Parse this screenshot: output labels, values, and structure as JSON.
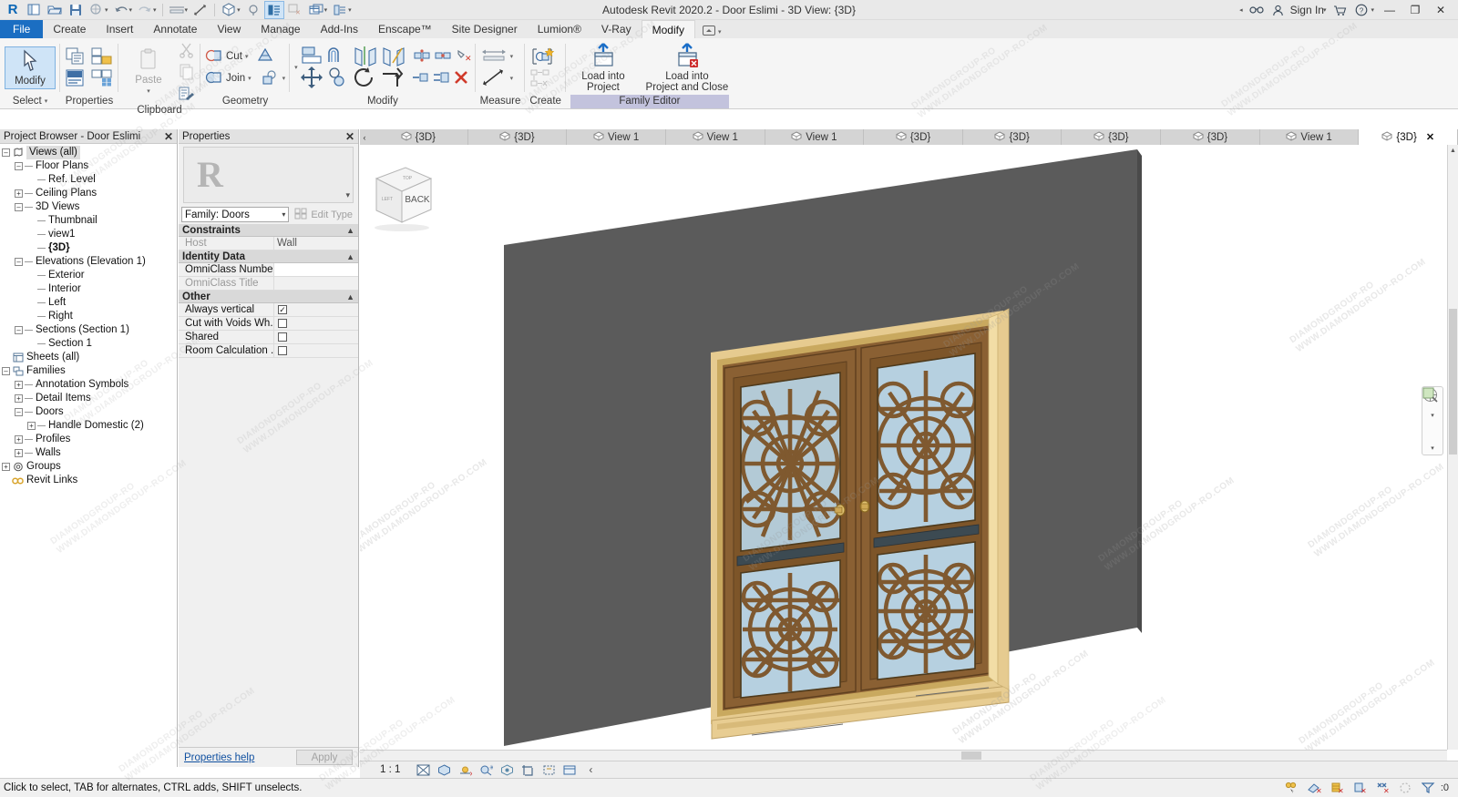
{
  "window": {
    "title": "Autodesk Revit 2020.2 - Door Eslimi - 3D View: {3D}",
    "sign_in": "Sign In",
    "minimize": "—",
    "restore": "❐",
    "close": "✕"
  },
  "quick_access": [
    {
      "name": "revit-logo-icon",
      "glyph": "R"
    },
    {
      "name": "new-project-icon",
      "glyph": "▤"
    },
    {
      "name": "open-file-icon",
      "glyph": "📂"
    },
    {
      "name": "save-icon",
      "glyph": "💾"
    },
    {
      "name": "save-as-icon",
      "glyph": "⬓"
    },
    {
      "name": "undo-icon",
      "glyph": "↩"
    },
    {
      "name": "redo-icon",
      "glyph": "↪"
    },
    {
      "name": "measure-icon",
      "glyph": "⇹"
    },
    {
      "name": "aligned-dimension-icon",
      "glyph": "↗"
    },
    {
      "name": "3d-view-icon",
      "glyph": "⬡"
    },
    {
      "name": "section-box-icon",
      "glyph": "⌀"
    },
    {
      "name": "thin-lines-icon",
      "glyph": "▤"
    },
    {
      "name": "close-hidden-windows-icon",
      "glyph": "⧉"
    },
    {
      "name": "switch-windows-icon",
      "glyph": "⧈"
    },
    {
      "name": "customize-qat-icon",
      "glyph": "▤"
    }
  ],
  "ribbon": {
    "tabs": [
      {
        "label": "File",
        "kind": "file"
      },
      {
        "label": "Create",
        "kind": "normal"
      },
      {
        "label": "Insert",
        "kind": "normal"
      },
      {
        "label": "Annotate",
        "kind": "normal"
      },
      {
        "label": "View",
        "kind": "normal"
      },
      {
        "label": "Manage",
        "kind": "normal"
      },
      {
        "label": "Add-Ins",
        "kind": "normal"
      },
      {
        "label": "Enscape™",
        "kind": "normal"
      },
      {
        "label": "Site Designer",
        "kind": "normal"
      },
      {
        "label": "Lumion®",
        "kind": "normal"
      },
      {
        "label": "V-Ray",
        "kind": "normal"
      },
      {
        "label": "Modify",
        "kind": "active"
      }
    ],
    "panels": {
      "select": {
        "title": "Select",
        "modify_label": "Modify"
      },
      "properties": {
        "title": "Properties"
      },
      "clipboard": {
        "title": "Clipboard",
        "paste_label": "Paste"
      },
      "geometry": {
        "title": "Geometry",
        "cut_label": "Cut",
        "join_label": "Join"
      },
      "modify": {
        "title": "Modify"
      },
      "measure": {
        "title": "Measure"
      },
      "create": {
        "title": "Create"
      },
      "family_editor": {
        "title": "Family Editor",
        "load_into_project": "Load into\nProject",
        "load_into_project_line1": "Load into",
        "load_into_project_line2": "Project",
        "load_into_project_close_line1": "Load into",
        "load_into_project_close_line2": "Project and Close"
      }
    }
  },
  "browser": {
    "header": "Project Browser - Door Eslimi",
    "close": "✕",
    "nodes": [
      {
        "label": "Views (all)",
        "depth": 0,
        "toggle": "minus",
        "icon": "views-icon",
        "selected": true
      },
      {
        "label": "Floor Plans",
        "depth": 1,
        "toggle": "minus",
        "icon": "",
        "selected": false
      },
      {
        "label": "Ref. Level",
        "depth": 2,
        "toggle": "none",
        "icon": "",
        "selected": false
      },
      {
        "label": "Ceiling Plans",
        "depth": 1,
        "toggle": "plus",
        "icon": "",
        "selected": false
      },
      {
        "label": "3D Views",
        "depth": 1,
        "toggle": "minus",
        "icon": "",
        "selected": false
      },
      {
        "label": "Thumbnail",
        "depth": 2,
        "toggle": "none",
        "icon": "",
        "selected": false
      },
      {
        "label": "view1",
        "depth": 2,
        "toggle": "none",
        "icon": "",
        "selected": false
      },
      {
        "label": "{3D}",
        "depth": 2,
        "toggle": "none",
        "icon": "",
        "selected": false,
        "bold": true
      },
      {
        "label": "Elevations (Elevation 1)",
        "depth": 1,
        "toggle": "minus",
        "icon": "",
        "selected": false
      },
      {
        "label": "Exterior",
        "depth": 2,
        "toggle": "none",
        "icon": "",
        "selected": false
      },
      {
        "label": "Interior",
        "depth": 2,
        "toggle": "none",
        "icon": "",
        "selected": false
      },
      {
        "label": "Left",
        "depth": 2,
        "toggle": "none",
        "icon": "",
        "selected": false
      },
      {
        "label": "Right",
        "depth": 2,
        "toggle": "none",
        "icon": "",
        "selected": false
      },
      {
        "label": "Sections (Section 1)",
        "depth": 1,
        "toggle": "minus",
        "icon": "",
        "selected": false
      },
      {
        "label": "Section 1",
        "depth": 2,
        "toggle": "none",
        "icon": "",
        "selected": false
      },
      {
        "label": "Sheets (all)",
        "depth": 0,
        "toggle": "none",
        "icon": "sheets-icon",
        "selected": false
      },
      {
        "label": "Families",
        "depth": 0,
        "toggle": "minus",
        "icon": "families-icon",
        "selected": false
      },
      {
        "label": "Annotation Symbols",
        "depth": 1,
        "toggle": "plus",
        "icon": "",
        "selected": false
      },
      {
        "label": "Detail Items",
        "depth": 1,
        "toggle": "plus",
        "icon": "",
        "selected": false
      },
      {
        "label": "Doors",
        "depth": 1,
        "toggle": "minus",
        "icon": "",
        "selected": false
      },
      {
        "label": "Handle Domestic (2)",
        "depth": 2,
        "toggle": "plus",
        "icon": "",
        "selected": false
      },
      {
        "label": "Profiles",
        "depth": 1,
        "toggle": "plus",
        "icon": "",
        "selected": false
      },
      {
        "label": "Walls",
        "depth": 1,
        "toggle": "plus",
        "icon": "",
        "selected": false
      },
      {
        "label": "Groups",
        "depth": 0,
        "toggle": "plus",
        "icon": "groups-icon",
        "selected": false
      },
      {
        "label": "Revit Links",
        "depth": 0,
        "toggle": "none",
        "icon": "revit-links-icon",
        "selected": false
      }
    ]
  },
  "properties": {
    "header": "Properties",
    "close": "✕",
    "type_selector": "Family: Doors",
    "edit_type": "Edit Type",
    "groups": [
      {
        "name": "Constraints",
        "rows": [
          {
            "name": "Host",
            "value": "Wall",
            "type": "text",
            "dim": true
          }
        ]
      },
      {
        "name": "Identity Data",
        "rows": [
          {
            "name": "OmniClass Number",
            "value": "",
            "type": "input",
            "dim": false
          },
          {
            "name": "OmniClass Title",
            "value": "",
            "type": "text",
            "dim": true
          }
        ]
      },
      {
        "name": "Other",
        "rows": [
          {
            "name": "Always vertical",
            "value": "",
            "type": "checkbox",
            "checked": true,
            "dim": false
          },
          {
            "name": "Cut with Voids Wh...",
            "value": "",
            "type": "checkbox",
            "checked": false,
            "dim": false
          },
          {
            "name": "Shared",
            "value": "",
            "type": "checkbox",
            "checked": false,
            "dim": false
          },
          {
            "name": "Room Calculation ...",
            "value": "",
            "type": "checkbox",
            "checked": false,
            "dim": false
          }
        ]
      }
    ],
    "help_link": "Properties help",
    "apply_button": "Apply"
  },
  "view_tabs": [
    {
      "label": "{3D}",
      "active": false
    },
    {
      "label": "{3D}",
      "active": false
    },
    {
      "label": "View 1",
      "active": false
    },
    {
      "label": "View 1",
      "active": false
    },
    {
      "label": "View 1",
      "active": false
    },
    {
      "label": "{3D}",
      "active": false
    },
    {
      "label": "{3D}",
      "active": false
    },
    {
      "label": "{3D}",
      "active": false
    },
    {
      "label": "{3D}",
      "active": false
    },
    {
      "label": "View 1",
      "active": false
    },
    {
      "label": "{3D}",
      "active": true
    }
  ],
  "viewcube": {
    "front_face": "BACK",
    "top_face": "TOP"
  },
  "view_control_bar": {
    "scale": "1 : 1",
    "icons": [
      "detail-level-icon",
      "visual-style-icon",
      "sun-path-icon",
      "shadows-icon",
      "render-icon",
      "crop-view-icon",
      "hide-crop-icon",
      "temporary-hide-isolate-icon",
      "reveal-hidden-icon"
    ],
    "expand": "‹"
  },
  "status_bar": {
    "message": "Click to select, TAB for alternates, CTRL adds, SHIFT unselects.",
    "right_icons": [
      "press-drag-icon",
      "editable-only-icon",
      "exclude-options-icon",
      "exclude-pinned-icon",
      "select-links-icon",
      "select-underlay-icon"
    ],
    "filter_count": ":0",
    "expand_arrow": "❯"
  },
  "watermark": {
    "line1": "DIAMONDGROUP-RO",
    "line2": "WWW.DIAMONDGROUP-RO.COM"
  },
  "colors": {
    "accent": "#1b6ec2",
    "ribbon_bg": "#f5f5f5",
    "family_editor_panel": "#c3c3dd",
    "wall_front": "#5a5a5a",
    "wall_side": "#3f3f3f",
    "door_wood": "#8a6033",
    "door_frame_gold": "#e8cd92",
    "glass_blue": "#b9d4e8"
  }
}
